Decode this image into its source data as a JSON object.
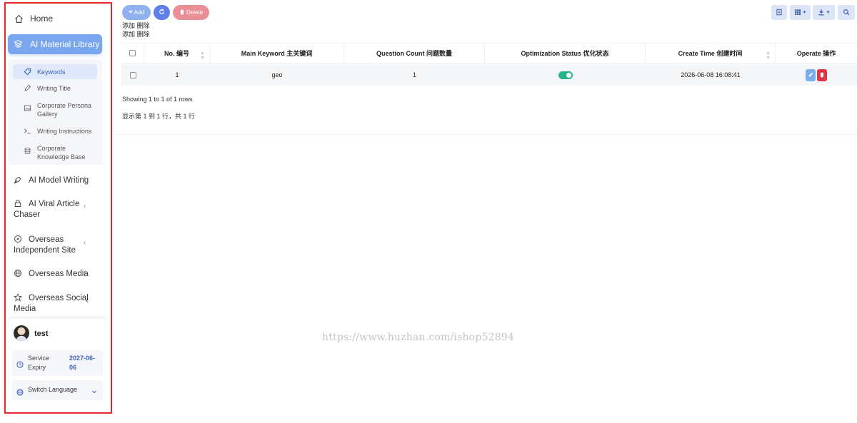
{
  "sidebar": {
    "home": "Home",
    "active_section": "AI Material Library",
    "submenu": [
      "Keywords",
      "Writing Title",
      "Corporate Persona Gallery",
      "Writing Instructions",
      "Corporate Knowledge Base"
    ],
    "groups": [
      "AI Model Writing",
      "AI Viral Article Chaser",
      "Overseas Independent Site",
      "Overseas Media",
      "Overseas Social Media"
    ],
    "user": {
      "name": "test",
      "expiry_label": "Service Expiry",
      "expiry_date": "2027-06-06",
      "language_label": "Switch Language"
    }
  },
  "toolbar": {
    "add_label": "Add",
    "delete_label": "Delete",
    "cn_line_1": "添加 删除",
    "cn_line_2": "添加 删除"
  },
  "table": {
    "columns": [
      "No. 编号",
      "Main Keyword 主关键词",
      "Question Count 问题数量",
      "Optimization Status 优化状态",
      "Create Time 创建时间",
      "Operate 操作"
    ],
    "rows": [
      {
        "no": "1",
        "keyword": "geo",
        "question_count": "1",
        "status_on": true,
        "create_time": "2026-06-08 16:08:41"
      }
    ],
    "summary_en": "Showing 1 to 1 of 1 rows",
    "summary_cn": "显示第 1 到 1 行，共 1 行"
  },
  "watermark": "https://www.huzhan.com/ishop52894",
  "colors": {
    "primary": "#7aa6ef",
    "success": "#27b38a",
    "danger": "#dc3545",
    "sidebar_border": "#e8272c"
  }
}
